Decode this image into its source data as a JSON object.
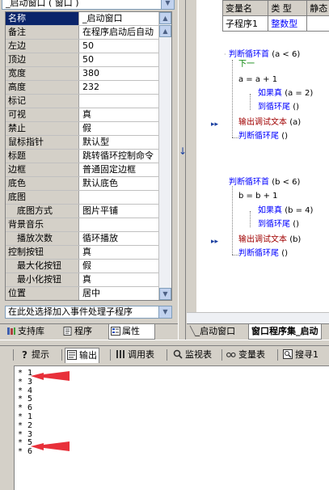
{
  "left_panel": {
    "window_selector": "_启动窗口 ( 窗口 )",
    "properties": [
      {
        "name": "名称",
        "value": "_启动窗口",
        "selected": true,
        "indent": false
      },
      {
        "name": "备注",
        "value": "在程序启动后自动",
        "indent": false
      },
      {
        "name": "左边",
        "value": "50",
        "indent": false
      },
      {
        "name": "顶边",
        "value": "50",
        "indent": false
      },
      {
        "name": "宽度",
        "value": "380",
        "indent": false
      },
      {
        "name": "高度",
        "value": "232",
        "indent": false
      },
      {
        "name": "标记",
        "value": "",
        "indent": false
      },
      {
        "name": "可视",
        "value": "真",
        "indent": false
      },
      {
        "name": "禁止",
        "value": "假",
        "indent": false
      },
      {
        "name": "鼠标指针",
        "value": "默认型",
        "indent": false
      },
      {
        "name": "标题",
        "value": "跳转循环控制命令",
        "indent": false
      },
      {
        "name": "边框",
        "value": "普通固定边框",
        "indent": false
      },
      {
        "name": "底色",
        "value": "默认底色",
        "indent": false
      },
      {
        "name": "底图",
        "value": "",
        "indent": false
      },
      {
        "name": "底图方式",
        "value": "图片平铺",
        "indent": true
      },
      {
        "name": "背景音乐",
        "value": "",
        "indent": false
      },
      {
        "name": "播放次数",
        "value": "循环播放",
        "indent": true
      },
      {
        "name": "控制按钮",
        "value": "真",
        "indent": false
      },
      {
        "name": "最大化按钮",
        "value": "假",
        "indent": true
      },
      {
        "name": "最小化按钮",
        "value": "真",
        "indent": true
      },
      {
        "name": "位置",
        "value": "居中",
        "indent": false
      }
    ],
    "event_selector": "在此处选择加入事件处理子程序",
    "tabs": [
      {
        "label": "支持库",
        "icon": "library-icon"
      },
      {
        "label": "程序",
        "icon": "program-icon"
      },
      {
        "label": "属性",
        "icon": "properties-icon",
        "active": true
      }
    ]
  },
  "editor": {
    "var_table": {
      "headers": [
        "变量名",
        "类 型",
        "静态"
      ],
      "row": {
        "name": "子程序1",
        "type": "整数型"
      }
    },
    "block1": {
      "loop_head_kw": "判断循环首",
      "loop_head_cond": "(a < 6)",
      "next_label": "下一",
      "assign": "a = a + 1",
      "if_kw": "如果真",
      "if_cond": "(a = 2)",
      "jump_kw": "到循环尾",
      "jump_args": "()",
      "debug_kw": "输出调试文本",
      "debug_args": "(a)",
      "loop_tail_kw": "判断循环尾",
      "loop_tail_args": "()"
    },
    "block2": {
      "loop_head_kw": "判断循环首",
      "loop_head_cond": "(b < 6)",
      "assign": "b = b + 1",
      "if_kw": "如果真",
      "if_cond": "(b = 4)",
      "jump_kw": "到循环尾",
      "jump_args": "()",
      "debug_kw": "输出调试文本",
      "debug_args": "(b)",
      "loop_tail_kw": "判断循环尾",
      "loop_tail_args": "()"
    },
    "tabs": [
      {
        "label": "_启动窗口"
      },
      {
        "label": "窗口程序集_启动",
        "active": true
      }
    ]
  },
  "bottom": {
    "tabs": [
      {
        "label": "提示",
        "icon": "hint-icon"
      },
      {
        "label": "输出",
        "icon": "output-icon",
        "active": true
      },
      {
        "label": "调用表",
        "icon": "call-table-icon"
      },
      {
        "label": "监视表",
        "icon": "watch-icon"
      },
      {
        "label": "变量表",
        "icon": "variables-icon"
      },
      {
        "label": "搜寻1",
        "icon": "search-icon"
      }
    ],
    "output_lines": [
      "* 1",
      "* 3",
      "* 4",
      "* 5",
      "* 6",
      "* 1",
      "* 2",
      "* 3",
      "* 5",
      "* 6"
    ]
  },
  "colors": {
    "accent_red": "#e8303a",
    "selection": "#0a246a",
    "keyword_blue": "#0000ff"
  }
}
